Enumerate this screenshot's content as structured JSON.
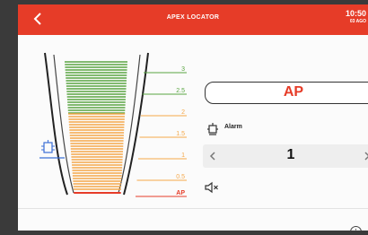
{
  "header": {
    "title": "APEX LOCATOR",
    "time": "10:50",
    "date": "03 AGO",
    "back_icon": "chevron-left-icon"
  },
  "colors": {
    "accent": "#e63c28",
    "green": "#5aa542",
    "orange": "#f5a84a",
    "red": "#e63c28"
  },
  "gauge": {
    "scale_labels": [
      "3",
      "2.5",
      "2",
      "1.5",
      "1",
      "0.5",
      "AP"
    ],
    "current_position": "AP",
    "apex_marker_icon": "apex-file-icon"
  },
  "display": {
    "reading": "AP"
  },
  "alarm": {
    "label": "Alarm",
    "icon": "alarm-bell-icon",
    "value": "1"
  },
  "sound": {
    "icon": "speaker-muted-icon"
  },
  "footer": {
    "info_icon": "info-icon",
    "info_glyph": "i"
  }
}
